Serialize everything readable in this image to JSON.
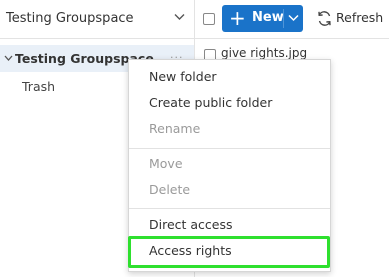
{
  "sidebar": {
    "space_selector": "Testing Groupspace",
    "tree": {
      "root_label": "Testing Groupspace",
      "more": "···",
      "children": [
        "Trash"
      ]
    }
  },
  "toolbar": {
    "new_label": "New",
    "refresh_label": "Refresh"
  },
  "files": [
    {
      "name": "give rights.jpg"
    }
  ],
  "context_menu": {
    "items": [
      {
        "label": "New folder",
        "enabled": true
      },
      {
        "label": "Create public folder",
        "enabled": true
      },
      {
        "label": "Rename",
        "enabled": false
      },
      {
        "label": "Move",
        "enabled": false
      },
      {
        "label": "Delete",
        "enabled": false
      },
      {
        "label": "Direct access",
        "enabled": true
      },
      {
        "label": "Access rights",
        "enabled": true
      }
    ]
  },
  "colors": {
    "accent": "#1a73c9",
    "selected_row": "#e9f0f8",
    "highlight": "#2ee02e"
  }
}
